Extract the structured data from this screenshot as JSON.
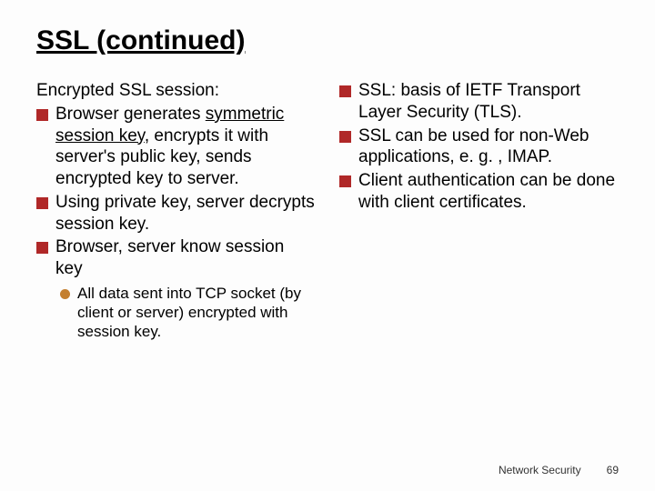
{
  "title": "SSL (continued)",
  "left": {
    "subhead": "Encrypted SSL session:",
    "b1_pre": "Browser generates ",
    "b1_key": "symmetric session key",
    "b1_post": ", encrypts it with server's public key, sends encrypted key to server.",
    "b2": "Using private key, server decrypts session key.",
    "b3": "Browser, server know session key",
    "sub": "All data sent into TCP socket (by client or server) encrypted with session key."
  },
  "right": {
    "b1": "SSL: basis of IETF Transport Layer Security (TLS).",
    "b2": "SSL can be used for non-Web applications, e. g. , IMAP.",
    "b3": "Client authentication can be done with client certificates."
  },
  "footer_label": "Network Security",
  "footer_page": "69"
}
